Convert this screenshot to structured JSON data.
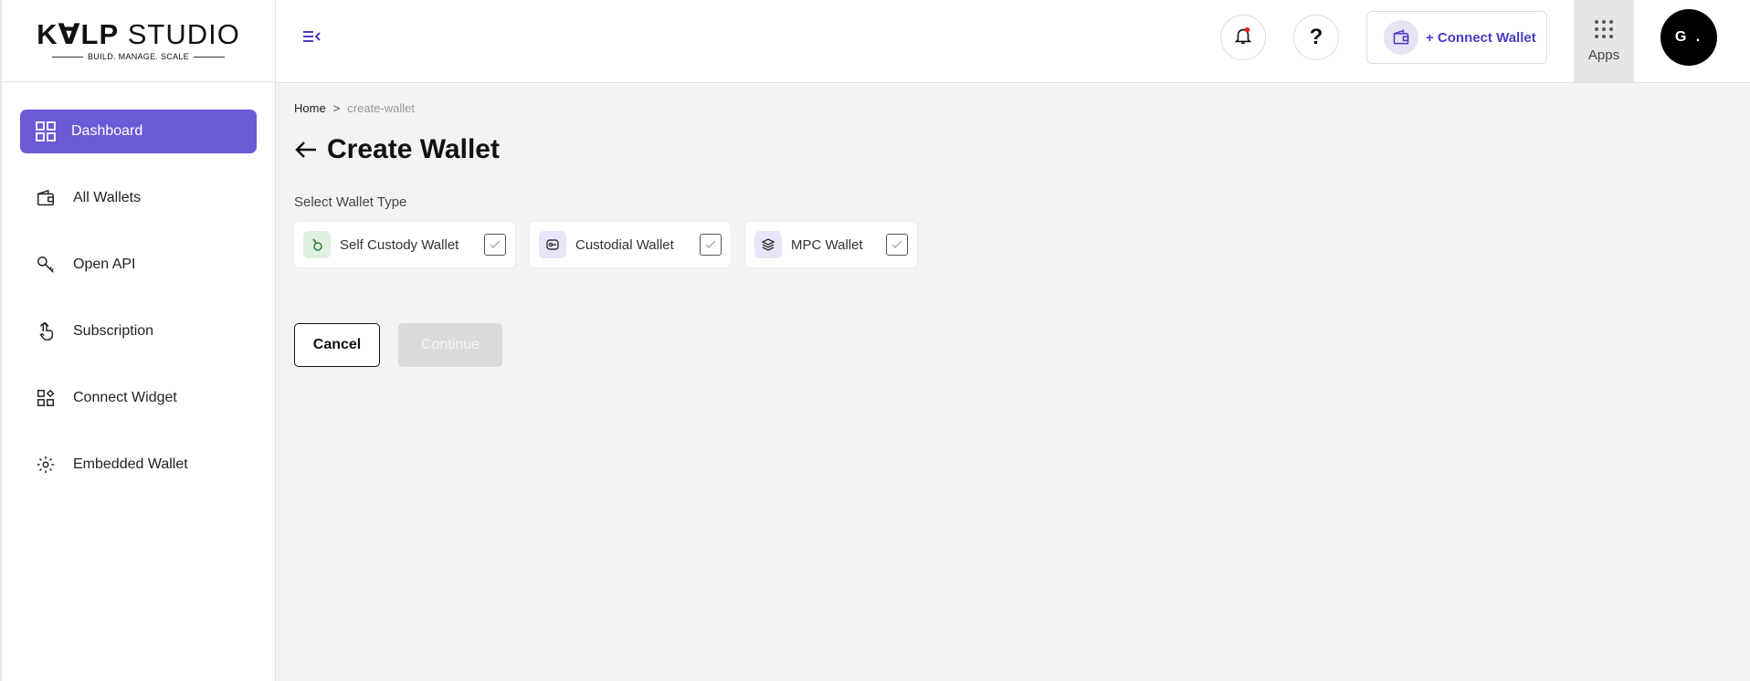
{
  "brand": {
    "name_bold": "K∀LP",
    "name_light": "STUDIO",
    "tagline": "BUILD. MANAGE. SCALE"
  },
  "sidebar": {
    "items": [
      {
        "label": "Dashboard",
        "icon": "grid-icon",
        "active": true
      },
      {
        "label": "All Wallets",
        "icon": "wallet-icon",
        "active": false
      },
      {
        "label": "Open API",
        "icon": "key-icon",
        "active": false
      },
      {
        "label": "Subscription",
        "icon": "hand-pointer-icon",
        "active": false
      },
      {
        "label": "Connect Widget",
        "icon": "widget-icon",
        "active": false
      },
      {
        "label": "Embedded Wallet",
        "icon": "gear-cog-icon",
        "active": false
      }
    ]
  },
  "header": {
    "help_label": "?",
    "connect_wallet_label": "+ Connect Wallet",
    "apps_label": "Apps",
    "avatar_initials": "G ."
  },
  "breadcrumb": {
    "home": "Home",
    "separator": ">",
    "current": "create-wallet"
  },
  "page": {
    "title": "Create Wallet",
    "section_label": "Select Wallet Type"
  },
  "wallet_types": [
    {
      "label": "Self Custody Wallet",
      "icon": "self-custody-icon"
    },
    {
      "label": "Custodial Wallet",
      "icon": "custodial-icon"
    },
    {
      "label": "MPC Wallet",
      "icon": "layers-icon"
    }
  ],
  "actions": {
    "cancel_label": "Cancel",
    "continue_label": "Continue"
  },
  "colors": {
    "accent": "#6b5ad6",
    "link": "#4b3cc4",
    "notification_dot": "#e02424"
  }
}
